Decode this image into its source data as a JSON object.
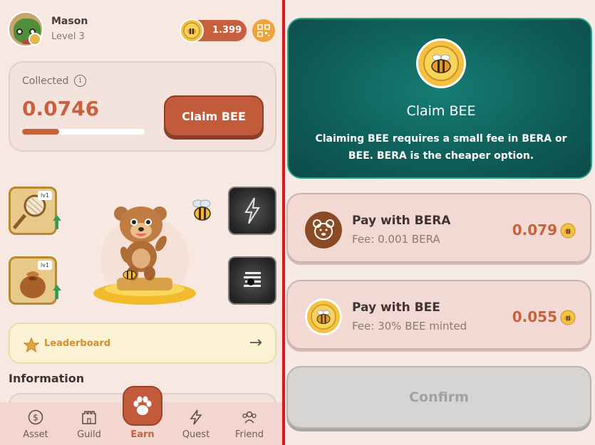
{
  "user": {
    "name": "Mason",
    "level": "Level 3"
  },
  "balance": {
    "value": "1.399"
  },
  "collected": {
    "label": "Collected",
    "value": "0.0746",
    "progress_fraction": 0.3,
    "claim_label": "Claim BEE"
  },
  "items": [
    {
      "name": "net",
      "level": "lv1"
    },
    {
      "name": "honey-sack",
      "level": "lv1"
    }
  ],
  "leaderboard": {
    "label": "Leaderboard"
  },
  "information": {
    "title": "Information"
  },
  "nav": {
    "items": [
      {
        "label": "Asset"
      },
      {
        "label": "Guild"
      },
      {
        "label": "Earn"
      },
      {
        "label": "Quest"
      },
      {
        "label": "Friend"
      }
    ],
    "active": "Earn"
  },
  "claim_panel": {
    "title": "Claim BEE",
    "description": "Claiming BEE requires a small fee in BERA or BEE. BERA is the cheaper option."
  },
  "payment_options": [
    {
      "title": "Pay with BERA",
      "fee": "Fee: 0.001 BERA",
      "amount": "0.079"
    },
    {
      "title": "Pay with BEE",
      "fee": "Fee: 30% BEE minted",
      "amount": "0.055"
    }
  ],
  "confirm": {
    "label": "Confirm"
  },
  "colors": {
    "accent": "#c25b3b",
    "teal": "#0f5d58",
    "divider": "#e0151b"
  }
}
